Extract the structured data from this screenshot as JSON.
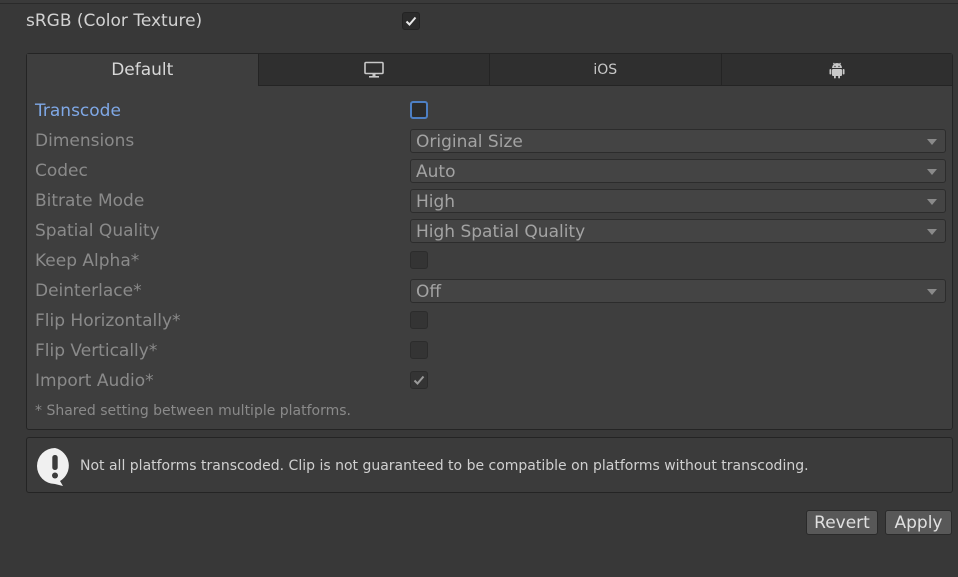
{
  "header": {
    "srgb_label": "sRGB (Color Texture)",
    "srgb_checked": true
  },
  "tabs": [
    {
      "label": "Default",
      "icon": null,
      "active": true
    },
    {
      "label": "",
      "icon": "monitor-icon",
      "active": false
    },
    {
      "label": "iOS",
      "icon": null,
      "active": false
    },
    {
      "label": "",
      "icon": "android-icon",
      "active": false
    }
  ],
  "settings": {
    "transcode": {
      "label": "Transcode",
      "checked": false
    },
    "dimensions": {
      "label": "Dimensions",
      "value": "Original Size"
    },
    "codec": {
      "label": "Codec",
      "value": "Auto"
    },
    "bitrate_mode": {
      "label": "Bitrate Mode",
      "value": "High"
    },
    "spatial_quality": {
      "label": "Spatial Quality",
      "value": "High Spatial Quality"
    },
    "keep_alpha": {
      "label": "Keep Alpha*",
      "checked": false
    },
    "deinterlace": {
      "label": "Deinterlace*",
      "value": "Off"
    },
    "flip_horizontally": {
      "label": "Flip Horizontally*",
      "checked": false
    },
    "flip_vertically": {
      "label": "Flip Vertically*",
      "checked": false
    },
    "import_audio": {
      "label": "Import Audio*",
      "checked": true
    },
    "footnote": "* Shared setting between multiple platforms."
  },
  "help": {
    "icon": "info-icon",
    "message": "Not all platforms transcoded. Clip is not guaranteed to be compatible on platforms without transcoding."
  },
  "buttons": {
    "revert": "Revert",
    "apply": "Apply"
  },
  "colors": {
    "background": "#383838",
    "accent": "#7fa8e6",
    "focus": "#4d7fc4"
  }
}
